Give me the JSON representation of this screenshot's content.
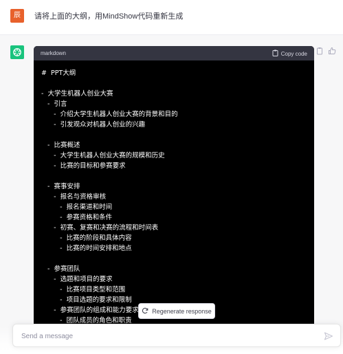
{
  "user": {
    "avatar_text": "辰",
    "message": "请将上面的大纲，用MindShow代码重新生成"
  },
  "assistant": {
    "code_block": {
      "language": "markdown",
      "copy_label": "Copy code",
      "lines": [
        "#  PPT大纲",
        "",
        "-  大学生机器人创业大赛",
        "   -  引言",
        "      -  介绍大学生机器人创业大赛的背景和目的",
        "      -  引发观众对机器人创业的兴趣",
        "",
        "   -  比赛概述",
        "      -  大学生机器人创业大赛的规模和历史",
        "      -  比赛的目标和参赛要求",
        "",
        "   -  赛事安排",
        "      -  报名与资格审核",
        "         -  报名渠道和时间",
        "         -  参赛资格和条件",
        "      -  初赛、复赛和决赛的流程和时间表",
        "         -  比赛的阶段和具体内容",
        "         -  比赛的时间安排和地点",
        "",
        "   -  参赛团队",
        "      -  选题和项目的要求",
        "         -  比赛项目类型和范围",
        "         -  项目选题的要求和限制",
        "      -  参赛团队的组成和能力要求",
        "         -  团队成员的角色和职责"
      ]
    }
  },
  "regenerate_label": "Regenerate response",
  "composer": {
    "placeholder": "Send a message"
  },
  "colors": {
    "user_avatar": "#e8612c",
    "gpt_avatar": "#19c37d",
    "code_bg": "#000000",
    "code_header_bg": "#343541"
  }
}
